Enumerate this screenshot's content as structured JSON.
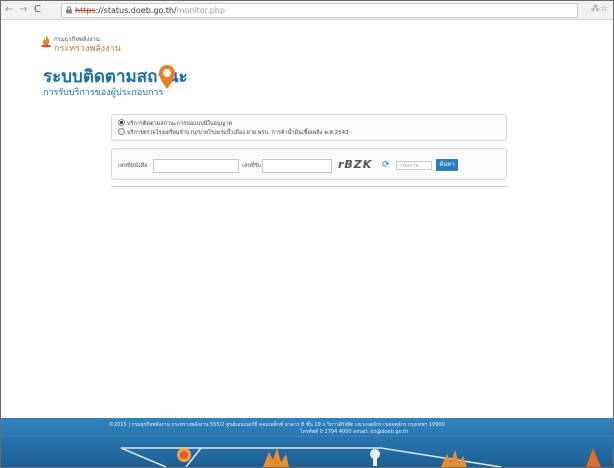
{
  "browser": {
    "url_scheme": "https",
    "url_rest": "://status.doeb.go.th/",
    "url_path": "monitor.php"
  },
  "header": {
    "ministry_line": "กรมธุรกิจพลังงาน",
    "ministry_name": "กระทรวงพลังงาน",
    "title": "ระบบติดตามสถานะ",
    "subtitle": "การรับบริการของผู้ประกอบการ"
  },
  "service_options": [
    {
      "label": "บริการติดตามสถานะการขอแบบมีใบอนุญาต",
      "selected": true
    },
    {
      "label": "บริการตรวจโรงเตรียมจำบวน/ขายโรงแรมป้ำเมือง ยาย พรบ. การค้าน้ำมันเชื้อเพลิง พ.ศ.2543",
      "selected": false
    }
  ],
  "search_form": {
    "doc_number_label": "เลขที่หนังสือ",
    "receipt_number_label": "เลขที่รับ",
    "captcha_text": "rBZK",
    "captcha_placeholder": "รหัสภาพ",
    "submit_label": "ค้นหา"
  },
  "footer": {
    "line1": "©2015 | กรมธุรกิจพลังงาน กระทรวงพลังงาน 555/2 ศูนย์เอนเนอร์ยี่ คอมเพล็กซ์ อาคาร B ชั้น 19 ถ.วิภาวดีรังสิต แขวงจตุจักร เขตจตุจักร กรุงเทพฯ 10900",
    "line2": "โทรศัพท์ 0 2794 4000 email: ict@doeb.go.th"
  }
}
